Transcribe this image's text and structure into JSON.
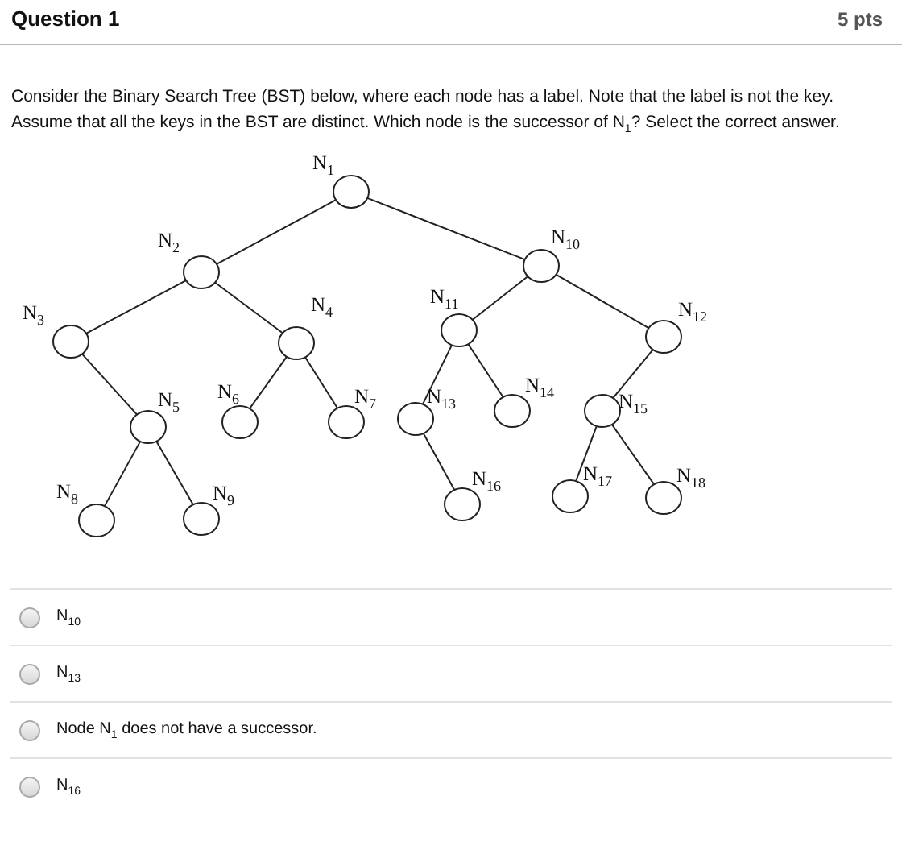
{
  "question": {
    "title": "Question 1",
    "points": "5 pts"
  },
  "prompt": "Consider the Binary Search Tree (BST) below, where each node has a label. Note that the label is not the key. Assume that all the keys in the BST are distinct. Which node is the successor of N$_{1}$? Select the correct answer.",
  "tree": {
    "label": "N$_{1}$",
    "left": {
      "label": "N$_{2}$",
      "left": {
        "label": "N$_{3}$",
        "right": {
          "label": "N$_{5}$",
          "left": {
            "label": "N$_{8}$"
          },
          "right": {
            "label": "N$_{9}$"
          }
        }
      },
      "right": {
        "label": "N$_{4}$",
        "left": {
          "label": "N$_{6}$"
        },
        "right": {
          "label": "N$_{7}$"
        }
      }
    },
    "right": {
      "label": "N$_{10}$",
      "left": {
        "label": "N$_{11}$",
        "left": {
          "label": "N$_{13}$",
          "right": {
            "label": "N$_{16}$"
          }
        },
        "right": {
          "label": "N$_{14}$"
        }
      },
      "right": {
        "label": "N$_{12}$",
        "left": {
          "label": "N$_{15}$",
          "left": {
            "label": "N$_{17}$"
          },
          "right": {
            "label": "N$_{18}$"
          }
        }
      }
    }
  },
  "options": [
    {
      "text": "N$_{10}$",
      "selected": false
    },
    {
      "text": "N$_{13}$",
      "selected": false
    },
    {
      "text": "Node N$_{1}$ does not have a successor.",
      "selected": false
    },
    {
      "text": "N$_{16}$",
      "selected": false
    }
  ]
}
